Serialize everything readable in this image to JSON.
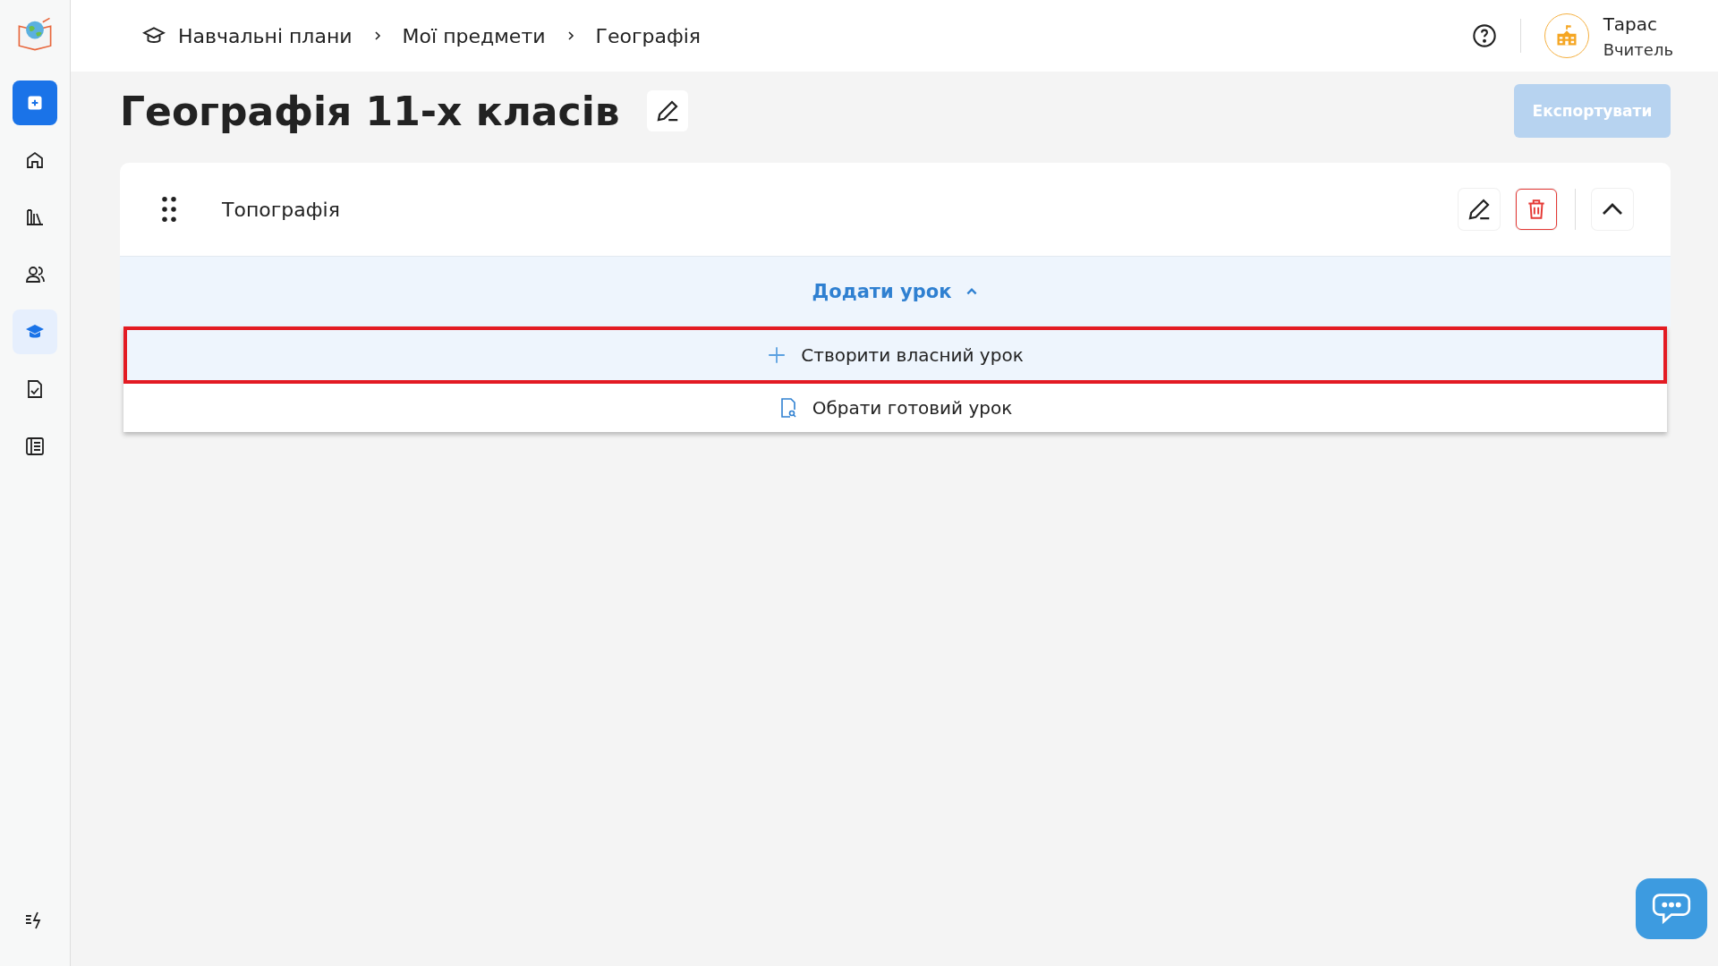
{
  "sidebar": {
    "items": [
      {
        "kind": "add",
        "selected": false
      },
      {
        "kind": "home",
        "selected": false
      },
      {
        "kind": "library",
        "selected": false
      },
      {
        "kind": "users",
        "selected": false
      },
      {
        "kind": "plans",
        "selected": true
      },
      {
        "kind": "tasks",
        "selected": false
      },
      {
        "kind": "journal",
        "selected": false
      }
    ]
  },
  "breadcrumbs": [
    "Навчальні плани",
    "Мої предмети",
    "Географія"
  ],
  "user": {
    "name": "Тарас",
    "role": "Вчитель"
  },
  "page": {
    "title": "Географія 11-х класів",
    "export_button": {
      "label": "Експортувати",
      "disabled": true
    }
  },
  "section": {
    "title": "Топографія",
    "expanded": true,
    "add_lesson": {
      "label": "Додати урок",
      "expanded": true,
      "options": [
        {
          "kind": "create",
          "label": "Створити власний урок",
          "highlighted": true
        },
        {
          "kind": "choose",
          "label": "Обрати готовий урок",
          "highlighted": false
        }
      ]
    }
  }
}
